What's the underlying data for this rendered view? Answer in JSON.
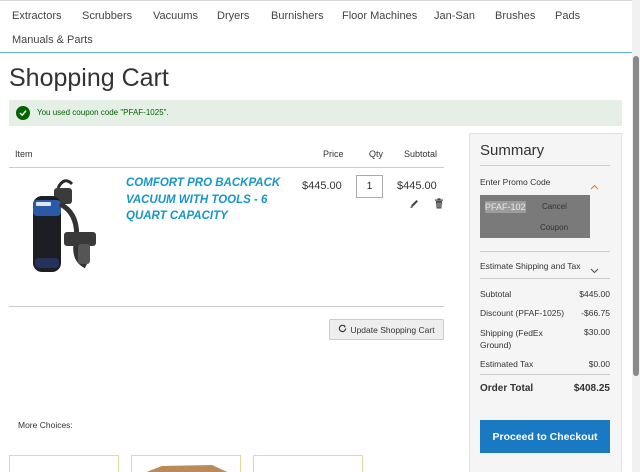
{
  "nav": {
    "items": [
      "Extractors",
      "Scrubbers",
      "Vacuums",
      "Dryers",
      "Burnishers",
      "Floor Machines",
      "Jan-San",
      "Brushes",
      "Pads",
      "Manuals & Parts"
    ]
  },
  "page": {
    "title": "Shopping Cart",
    "alert": "You used coupon code \"PFAF-1025\"."
  },
  "cart": {
    "headers": {
      "item": "Item",
      "price": "Price",
      "qty": "Qty",
      "subtotal": "Subtotal"
    },
    "item": {
      "name": "COMFORT PRO BACKPACK VACUUM WITH TOOLS - 6 QUART CAPACITY",
      "price": "$445.00",
      "qty": "1",
      "subtotal": "$445.00"
    },
    "update_label": "Update Shopping Cart",
    "more_choices": "More Choices:"
  },
  "summary": {
    "title": "Summary",
    "promo_label": "Enter Promo Code",
    "promo_value": "PFAF-102",
    "cancel_label": "Cancel",
    "coupon_label": "Coupon",
    "shipping_label": "Estimate Shipping and Tax",
    "rows": [
      {
        "label": "Subtotal",
        "value": "$445.00"
      },
      {
        "label": "Discount (PFAF-1025)",
        "value": "-$66.75"
      },
      {
        "label": "Shipping (FedEx Ground)",
        "value": "$30.00"
      },
      {
        "label": "Estimated Tax",
        "value": "$0.00"
      }
    ],
    "order_total_label": "Order Total",
    "order_total_value": "$408.25",
    "checkout_label": "Proceed to Checkout"
  },
  "colors": {
    "accent": "#1979c3",
    "link": "#1597c7",
    "success": "#006400",
    "success_bg": "#e5efe5"
  }
}
